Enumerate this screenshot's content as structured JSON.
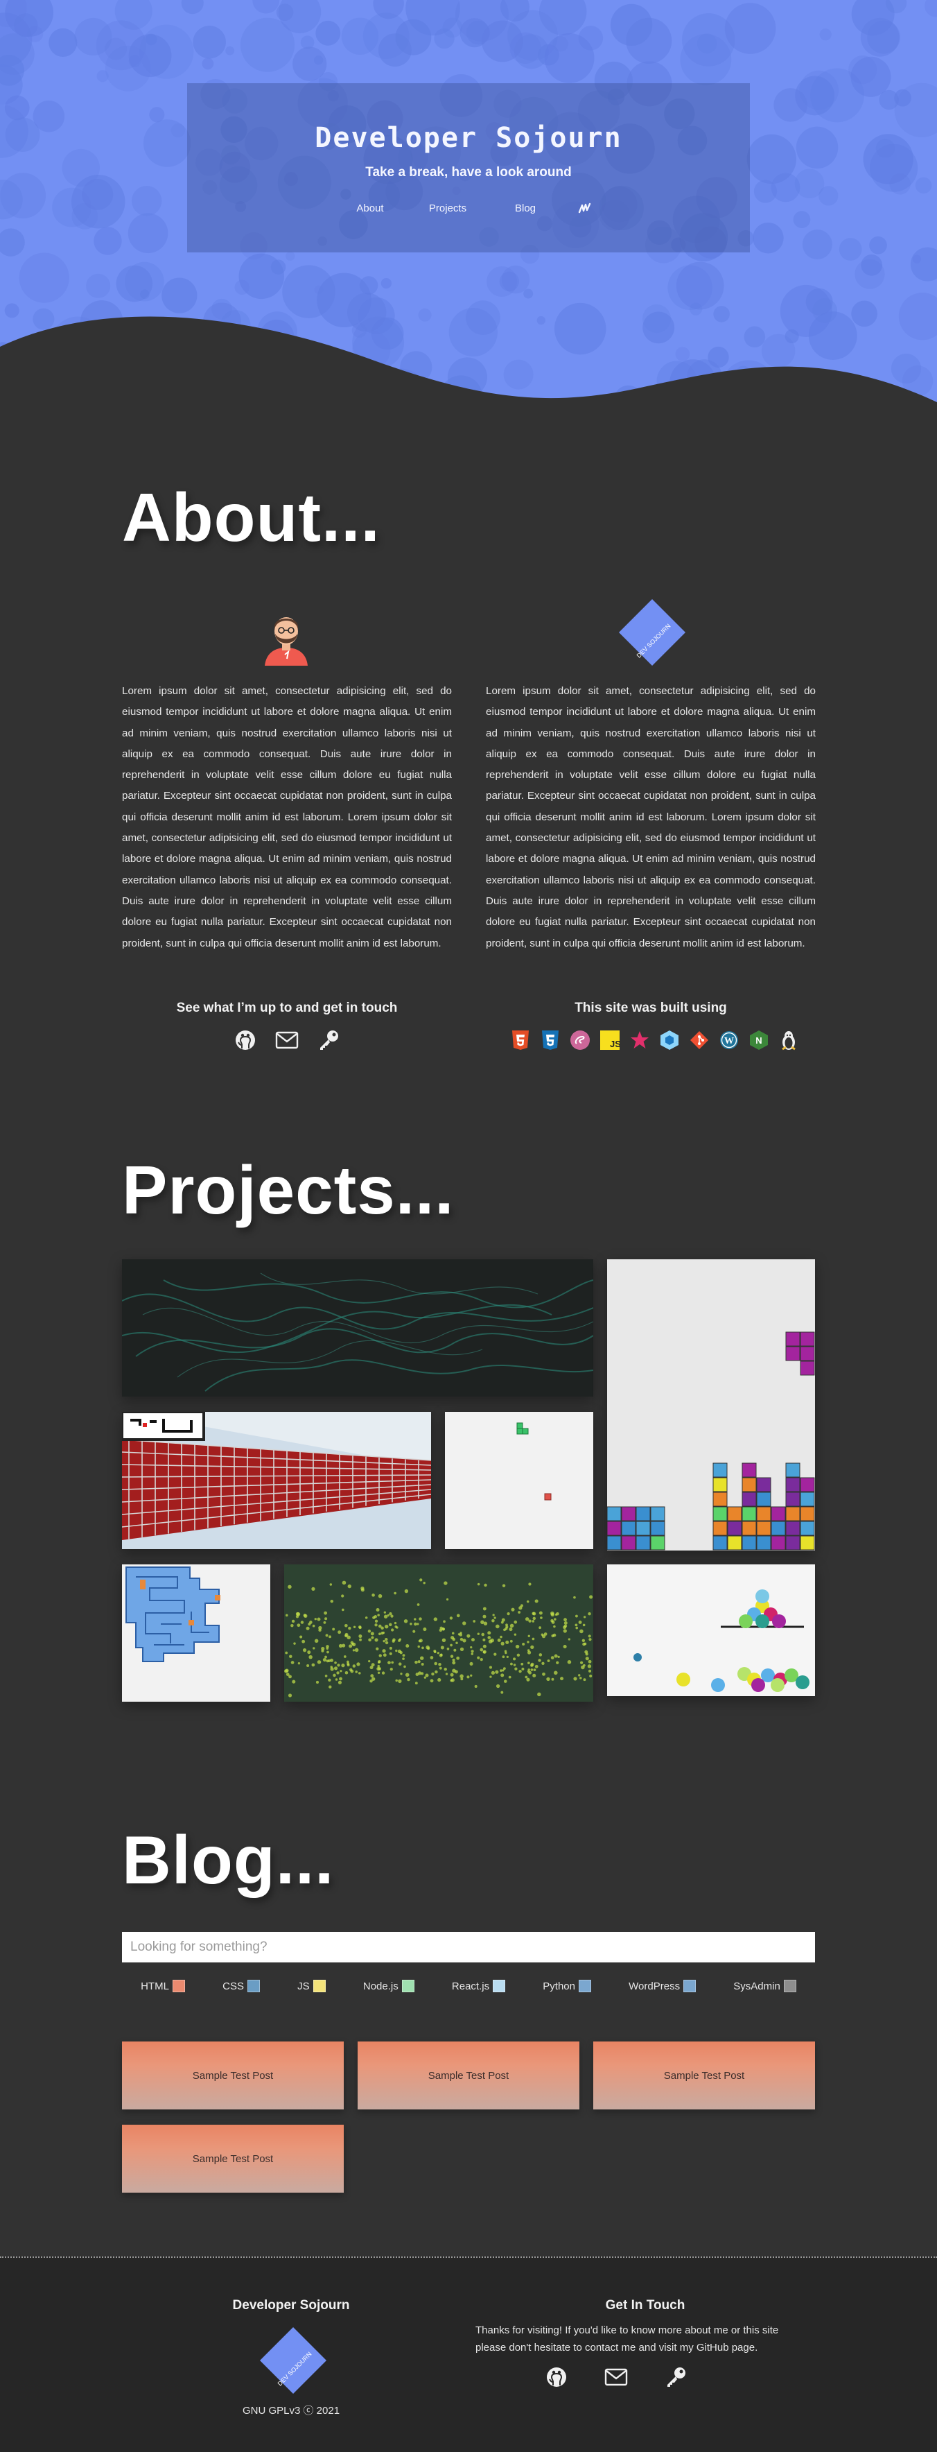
{
  "header": {
    "title": "Developer Sojourn",
    "tagline": "Take a break, have a look around",
    "nav": [
      "About",
      "Projects",
      "Blog"
    ],
    "nav_extra_icon": "code-scribble-icon"
  },
  "about": {
    "heading": "About...",
    "avatar_icon": "developer-avatar-icon",
    "logo_icon": "dev-sojourn-logo",
    "logo_text": "DEV SOJOURN",
    "paragraph": "Lorem ipsum dolor sit amet, consectetur adipisicing elit, sed do eiusmod tempor incididunt ut labore et dolore magna aliqua. Ut enim ad minim veniam, quis nostrud exercitation ullamco laboris nisi ut aliquip ex ea commodo consequat. Duis aute irure dolor in reprehenderit in voluptate velit esse cillum dolore eu fugiat nulla pariatur. Excepteur sint occaecat cupidatat non proident, sunt in culpa qui officia deserunt mollit anim id est laborum. Lorem ipsum dolor sit amet, consectetur adipisicing elit, sed do eiusmod tempor incididunt ut labore et dolore magna aliqua. Ut enim ad minim veniam, quis nostrud exercitation ullamco laboris nisi ut aliquip ex ea commodo consequat. Duis aute irure dolor in reprehenderit in voluptate velit esse cillum dolore eu fugiat nulla pariatur. Excepteur sint occaecat cupidatat non proident, sunt in culpa qui officia deserunt mollit anim id est laborum.",
    "contact_heading": "See what I’m up to and get in touch",
    "contact_icons": [
      "github-icon",
      "mail-icon",
      "key-icon"
    ],
    "built_heading": "This site was built using",
    "tech_icons": [
      "html5-icon",
      "css3-icon",
      "sass-icon",
      "javascript-icon",
      "star-icon",
      "webpack-icon",
      "git-icon",
      "wordpress-icon",
      "nodejs-icon",
      "linux-icon"
    ]
  },
  "projects": {
    "heading": "Projects...",
    "items": [
      "smoke-simulation-project",
      "tetris-project",
      "brick-wall-3d-project",
      "snake-game-project",
      "maze-project",
      "particle-text-project",
      "bouncing-balls-project"
    ]
  },
  "blog": {
    "heading": "Blog...",
    "search_placeholder": "Looking for something?",
    "tags": [
      {
        "label": "HTML",
        "color": "#ea8a6f"
      },
      {
        "label": "CSS",
        "color": "#6a9dc4"
      },
      {
        "label": "JS",
        "color": "#f3e37a"
      },
      {
        "label": "Node.js",
        "color": "#9fe0b0"
      },
      {
        "label": "React.js",
        "color": "#b9dcf0"
      },
      {
        "label": "Python",
        "color": "#7ba7cf"
      },
      {
        "label": "WordPress",
        "color": "#7ba7cf"
      },
      {
        "label": "SysAdmin",
        "color": "#8e8e8e"
      }
    ],
    "posts": [
      "Sample Test Post",
      "Sample Test Post",
      "Sample Test Post",
      "Sample Test Post"
    ]
  },
  "footer": {
    "title": "Developer Sojourn",
    "license": "GNU GPLv3 ⓒ 2021",
    "contact_title": "Get In Touch",
    "contact_text_1": "Thanks for visiting! If you'd like to know more about me or this site",
    "contact_text_2": "please don't hesitate to contact me and visit my GitHub page.",
    "contact_icons": [
      "github-icon",
      "mail-icon",
      "key-icon"
    ]
  },
  "colors": {
    "hero_blue": "#7390f3",
    "background": "#323232",
    "footer_bg": "#262626",
    "card_orange": "#e98463"
  }
}
